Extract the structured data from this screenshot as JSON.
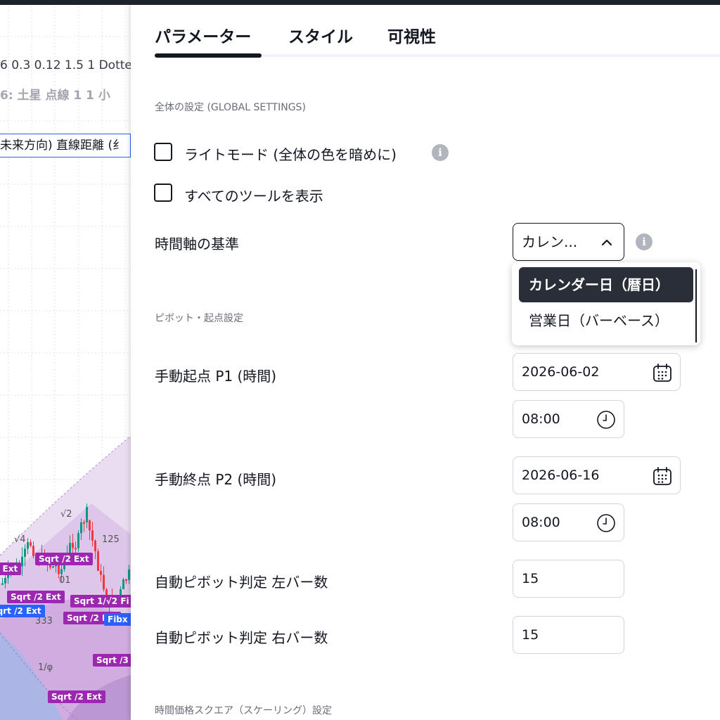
{
  "chart": {
    "legend_line1": "6 0.3 0.12 1.5 1 Dotte",
    "legend_line2": "6: 土星 点線 1 1 小",
    "legend_line3": "未来方向) 直線距離 (纟",
    "labels": {
      "sqrt2_1": "√2",
      "sqrt4": "√4",
      "l125": "125",
      "l333": "333",
      "l01": "01",
      "phi": "1/φ",
      "fib1": "Sqrt /2 Ext",
      "fib2": "Sqrt /2 Ext",
      "fib3": "Sqrt /2 Ext",
      "fib4": "Sqrt 1/√2 Fi",
      "fib5": "Sqrt /2 Ext",
      "fib6": "Sqrt /3",
      "fib7": "Sqrt /2 Ext",
      "fib8": "2 Ext",
      "fib9": "Fibx"
    }
  },
  "tabs": [
    {
      "label": "パラメーター",
      "active": true
    },
    {
      "label": "スタイル",
      "active": false
    },
    {
      "label": "可視性",
      "active": false
    }
  ],
  "global_settings": {
    "title": "全体の設定 (GLOBAL SETTINGS)",
    "light_mode": {
      "label": "ライトモード (全体の色を暗めに)",
      "checked": false
    },
    "show_all_tools": {
      "label": "すべてのツールを表示",
      "checked": false
    },
    "time_axis": {
      "label": "時間軸の基準",
      "selected": "カレン...",
      "options": [
        "カレンダー日（暦日）",
        "営業日（バーベース）"
      ],
      "selected_index": 0
    }
  },
  "pivot_settings": {
    "title": "ピボット・起点設定",
    "p1": {
      "label": "手動起点 P1 (時間)",
      "date": "2026-06-02",
      "time": "08:00"
    },
    "p2": {
      "label": "手動終点 P2 (時間)",
      "date": "2026-06-16",
      "time": "08:00"
    },
    "left_bars": {
      "label": "自動ピボット判定 左バー数",
      "value": "15"
    },
    "right_bars": {
      "label": "自動ピボット判定 右バー数",
      "value": "15"
    }
  },
  "scaling_settings": {
    "title": "時間価格スクエア（スケーリング）設定"
  },
  "colors": {
    "accent": "#131722",
    "checkbox_border": "#131722",
    "label_purple": "#9c27b0",
    "label_blue": "#2962ff",
    "candle_up": "#089981",
    "candle_down": "#f23645"
  }
}
